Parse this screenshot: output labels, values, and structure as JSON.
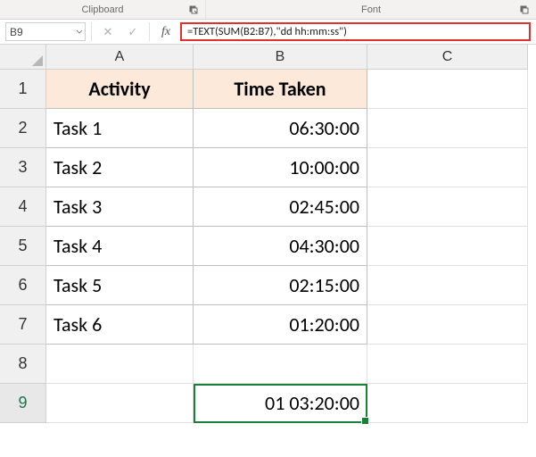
{
  "ribbon": {
    "groups": {
      "clipboard": "Clipboard",
      "font": "Font"
    }
  },
  "name_box": {
    "value": "B9"
  },
  "formula_bar": {
    "cancel_glyph": "✕",
    "enter_glyph": "✓",
    "fx_label": "fx",
    "formula": "=TEXT(SUM(B2:B7),\"dd hh:mm:ss\")"
  },
  "columns": [
    "A",
    "B",
    "C"
  ],
  "row_numbers": [
    "1",
    "2",
    "3",
    "4",
    "5",
    "6",
    "7",
    "8",
    "9"
  ],
  "active_cell": "B9",
  "headers": {
    "activity": "Activity",
    "time_taken": "Time Taken"
  },
  "rows": [
    {
      "activity": "Task 1",
      "time": "06:30:00"
    },
    {
      "activity": "Task 2",
      "time": "10:00:00"
    },
    {
      "activity": "Task 3",
      "time": "02:45:00"
    },
    {
      "activity": "Task 4",
      "time": "04:30:00"
    },
    {
      "activity": "Task 5",
      "time": "02:15:00"
    },
    {
      "activity": "Task 6",
      "time": "01:20:00"
    }
  ],
  "result_cell": "01 03:20:00",
  "chart_data": {
    "type": "table",
    "title": "",
    "columns": [
      "Activity",
      "Time Taken"
    ],
    "rows": [
      [
        "Task 1",
        "06:30:00"
      ],
      [
        "Task 2",
        "10:00:00"
      ],
      [
        "Task 3",
        "02:45:00"
      ],
      [
        "Task 4",
        "04:30:00"
      ],
      [
        "Task 5",
        "02:15:00"
      ],
      [
        "Task 6",
        "01:20:00"
      ]
    ],
    "formula_cell": {
      "ref": "B9",
      "formula": "=TEXT(SUM(B2:B7),\"dd hh:mm:ss\")",
      "value": "01 03:20:00"
    }
  }
}
